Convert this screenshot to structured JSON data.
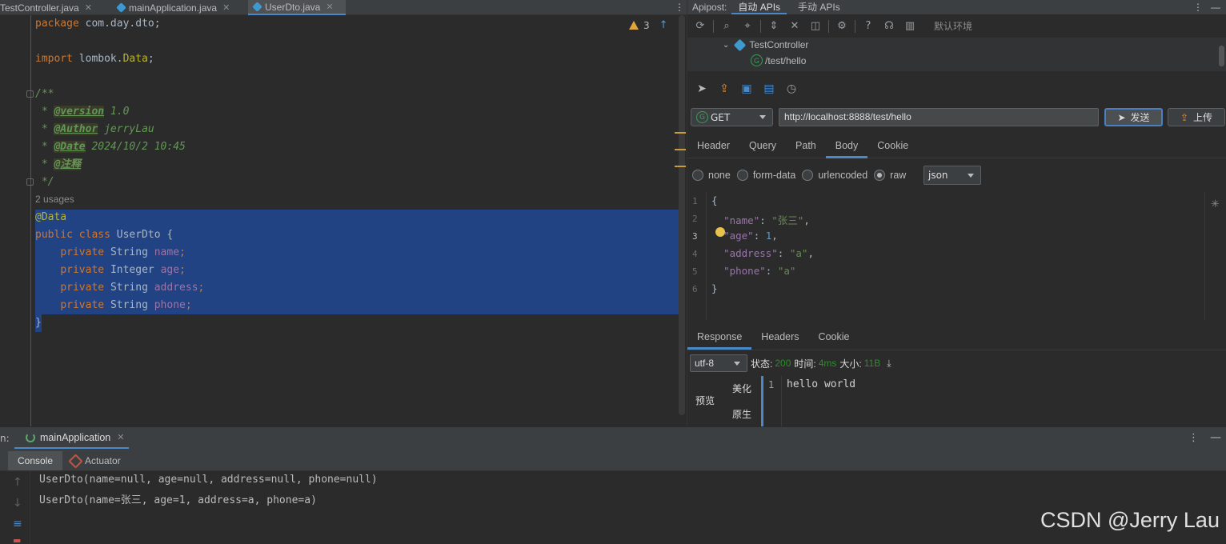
{
  "editor": {
    "tabs": [
      {
        "label": "TestController.java",
        "icon": "java-class-icon"
      },
      {
        "label": "mainApplication.java",
        "icon": "spring-class-icon"
      },
      {
        "label": "UserDto.java",
        "icon": "java-class-icon",
        "active": true
      }
    ],
    "inspection": {
      "warnings": "3"
    },
    "usages": "2 usages",
    "code": {
      "pkg_kw": "package",
      "pkg_name": " com.day.dto;",
      "imp_kw": "import",
      "imp_name": " lombok.",
      "imp_cls": "Data",
      "imp_end": ";",
      "doc_open": "/**",
      "tag_version": "@version",
      "val_version": " 1.0",
      "tag_author": "@Author",
      "val_author": " jerryLau",
      "tag_date": "@Date",
      "val_date": " 2024/10/2 10:45",
      "tag_note": "@注释",
      "doc_close": " */",
      "ann_data": "@Data",
      "cls_kw": "public class",
      "cls_name": " UserDto {",
      "fields": [
        {
          "type": "String",
          "name": "name"
        },
        {
          "type": "Integer",
          "name": "age"
        },
        {
          "type": "String",
          "name": "address"
        },
        {
          "type": "String",
          "name": "phone"
        }
      ],
      "private_kw": "private",
      "close": "}"
    }
  },
  "apipost": {
    "title": "Apipost:",
    "tabs": [
      "自动 APIs",
      "手动 APIs"
    ],
    "env_label": "默认环境",
    "tree": {
      "controller": "TestController",
      "endpoint": "/test/hello",
      "method_badge": "G"
    },
    "method": "GET",
    "url": "http://localhost:8888/test/hello",
    "send_label": "发送",
    "upload_label": "上传",
    "request_tabs": [
      "Header",
      "Query",
      "Path",
      "Body",
      "Cookie"
    ],
    "body_types": [
      "none",
      "form-data",
      "urlencoded",
      "raw"
    ],
    "body_format": "json",
    "body_lines": [
      {
        "n": "1",
        "text": "{"
      },
      {
        "n": "2",
        "key": "\"name\"",
        "val": "\"张三\"",
        "kind": "str",
        "comma": ","
      },
      {
        "n": "3",
        "key": "\"age\"",
        "val": "1",
        "kind": "num",
        "comma": ","
      },
      {
        "n": "4",
        "key": "\"address\"",
        "val": "\"a\"",
        "kind": "str",
        "comma": ","
      },
      {
        "n": "5",
        "key": "\"phone\"",
        "val": "\"a\"",
        "kind": "str",
        "comma": ""
      },
      {
        "n": "6",
        "text": "}"
      }
    ],
    "response_tabs": [
      "Response",
      "Headers",
      "Cookie"
    ],
    "charset": "utf-8",
    "status_label": "状态:",
    "status": "200",
    "time_label": "时间:",
    "time": "4ms",
    "size_label": "大小:",
    "size": "11B",
    "view_preview": "预览",
    "view_pretty": "美化",
    "view_raw": "原生",
    "response_line_no": "1",
    "response_text": "hello world"
  },
  "run": {
    "label": "n:",
    "tab": "mainApplication",
    "console_tab": "Console",
    "actuator_tab": "Actuator",
    "lines": [
      "UserDto(name=null, age=null, address=null, phone=null)",
      "UserDto(name=张三, age=1, address=a, phone=a)"
    ]
  },
  "watermark": "CSDN @Jerry Lau"
}
